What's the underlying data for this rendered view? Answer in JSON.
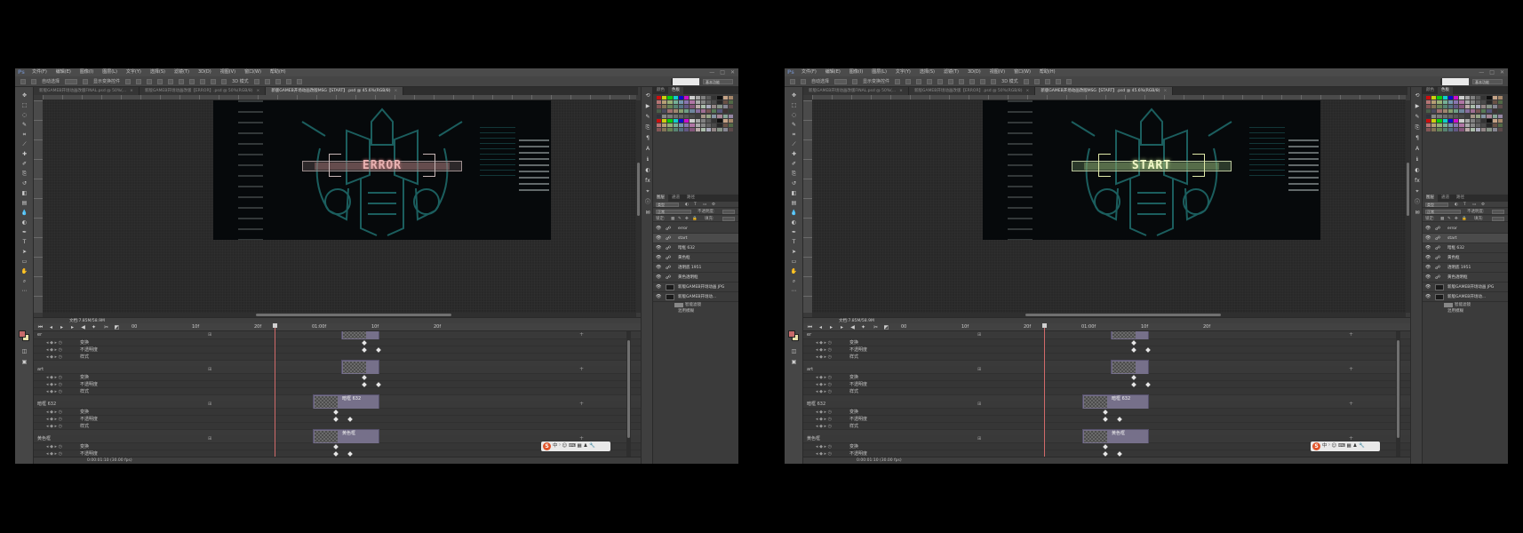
{
  "app": {
    "menu": [
      "文件(F)",
      "编辑(E)",
      "图像(I)",
      "图层(L)",
      "文字(Y)",
      "选择(S)",
      "滤镜(T)",
      "3D(D)",
      "视图(V)",
      "窗口(W)",
      "帮助(H)"
    ],
    "window_controls": [
      "—",
      "□",
      "✕"
    ]
  },
  "options_bar": {
    "auto_select": "自动选择",
    "transform_controls": "显示变换控件",
    "mode_3d": "3D 模式",
    "workspace": "基本功能"
  },
  "screens": [
    {
      "tabs": [
        "新版GAMEB开场动画改版FINAL.psd @ 50%(...",
        "新版GAMEB开场动画改版【ERROR】.psd @ 50%(RGB/8)",
        "新版GAMEB开场动画改版MSG【START】.psd @ 45.6%(RGB/8)"
      ],
      "active_tab": 2,
      "canvas_text": "ERROR",
      "status": "文档:7.85M/58.9M",
      "timeline_ruler": [
        "00",
        "10f",
        "20f",
        "01:00f",
        "10f",
        "20f"
      ],
      "layers": [
        {
          "name": "er",
          "props": [
            "变换",
            "不透明度",
            "样式"
          ]
        },
        {
          "name": "art",
          "props": [
            "变换",
            "不透明度",
            "样式"
          ]
        },
        {
          "name": "暗框 632",
          "props": [
            "变换",
            "不透明度",
            "样式"
          ]
        },
        {
          "name": "黄色框",
          "props": [
            "变换",
            "不透明度",
            "样式"
          ]
        },
        {
          "name": "透明底 1951",
          "props": [
            "变换"
          ]
        }
      ],
      "footer": "0:00:01:10 (30.00 fps)",
      "ime": "中 ⁾ ☺ ⌨ ▦ ♟ 🔧",
      "panel_tabs": [
        "颜色",
        "色板"
      ],
      "layers_panel": {
        "tabs": [
          "图层",
          "通道",
          "路径"
        ],
        "filter": "类型",
        "blend_mode": "正常",
        "opacity_label": "不透明度:",
        "lock_label": "锁定:",
        "fill_label": "填充:",
        "items": [
          "error",
          "start",
          "暗框 632",
          "黄色框",
          "透明底 1951",
          "黄色透明框",
          "新版GAMEB开场动画 JPG",
          "新版GAMEB开场动..."
        ],
        "sub_items": [
          "智能滤镜",
          "混用模糊"
        ]
      }
    },
    {
      "tabs": [
        "新版GAMEB开场动画改版FINAL.psd @ 50%(...",
        "新版GAMEB开场动画改版【ERROR】.psd @ 50%(RGB/8)",
        "新版GAMEB开场动画改版MSG【START】.psd @ 45.6%(RGB/8)"
      ],
      "active_tab": 2,
      "canvas_text": "START",
      "status": "文档:7.85M/58.9M",
      "timeline_ruler": [
        "00",
        "10f",
        "20f",
        "01:00f",
        "10f",
        "20f"
      ],
      "layers": [
        {
          "name": "er",
          "props": [
            "变换",
            "不透明度",
            "样式"
          ]
        },
        {
          "name": "art",
          "props": [
            "变换",
            "不透明度",
            "样式"
          ]
        },
        {
          "name": "暗框 632",
          "props": [
            "变换",
            "不透明度",
            "样式"
          ]
        },
        {
          "name": "黄色框",
          "props": [
            "变换",
            "不透明度",
            "样式"
          ]
        },
        {
          "name": "透明底 1951",
          "props": [
            "变换"
          ]
        }
      ],
      "footer": "0:00:01:10 (30.00 fps)",
      "ime": "中 ⁾ ☺ ⌨ ▦ ♟ 🔧",
      "panel_tabs": [
        "颜色",
        "色板"
      ],
      "layers_panel": {
        "tabs": [
          "图层",
          "通道",
          "路径"
        ],
        "filter": "类型",
        "blend_mode": "正常",
        "opacity_label": "不透明度:",
        "lock_label": "锁定:",
        "fill_label": "填充:",
        "items": [
          "error",
          "start",
          "暗框 632",
          "黄色框",
          "透明底 1951",
          "黄色透明框",
          "新版GAMEB开场动画 JPG",
          "新版GAMEB开场动..."
        ],
        "sub_items": [
          "智能滤镜",
          "混用模糊"
        ]
      }
    }
  ],
  "colors": {
    "error_glow": "#e9b2b2",
    "start_glow": "#f0f6c7",
    "robot_teal": "#1f6d6d",
    "clip_purple": "#76708a",
    "playhead": "#d06a6a"
  }
}
